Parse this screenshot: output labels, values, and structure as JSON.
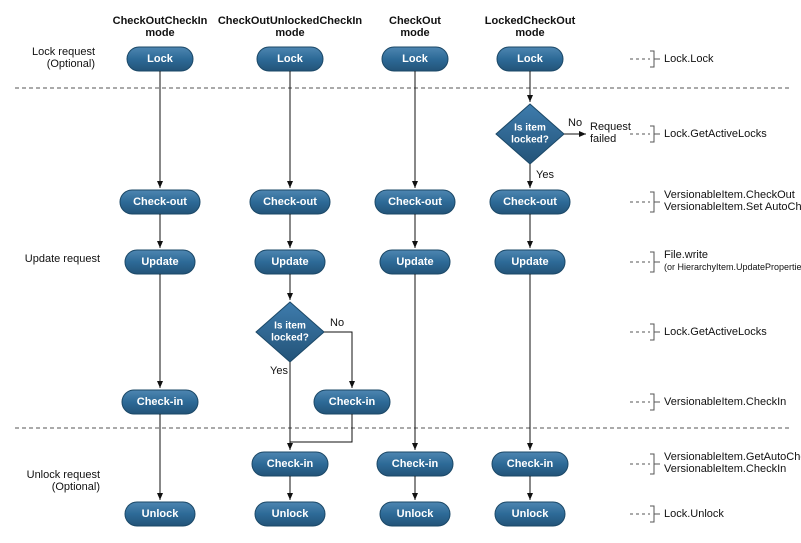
{
  "columns": [
    {
      "line1": "CheckOutCheckIn",
      "line2": "mode"
    },
    {
      "line1": "CheckOutUnlockedCheckIn",
      "line2": "mode"
    },
    {
      "line1": "CheckOut",
      "line2": "mode"
    },
    {
      "line1": "LockedCheckOut",
      "line2": "mode"
    }
  ],
  "row_labels": {
    "lock": {
      "l1": "Lock request",
      "l2": "(Optional)"
    },
    "update": "Update request",
    "unlock": {
      "l1": "Unlock request",
      "l2": "(Optional)"
    }
  },
  "nodes": {
    "lock": "Lock",
    "checkout": "Check-out",
    "update": "Update",
    "checkin": "Check-in",
    "unlock": "Unlock"
  },
  "decision": {
    "l1": "Is item",
    "l2": "locked?"
  },
  "branch": {
    "yes": "Yes",
    "no": "No",
    "request_failed1": "Request",
    "request_failed2": "failed"
  },
  "annotations": {
    "lock_lock": "Lock.Lock",
    "get_active_locks": "Lock.GetActiveLocks",
    "checkout_l1": "VersionableItem.CheckOut",
    "checkout_l2": "VersionableItem.Set AutoCheckIn",
    "file_write": "File.write",
    "file_write_sub": "(or   HierarchyItem.UpdateProperties)",
    "checkin": "VersionableItem.CheckIn",
    "auto_checkin_l1": "VersionableItem.GetAutoCheckIn",
    "auto_checkin_l2": "VersionableItem.CheckIn",
    "lock_unlock": "Lock.Unlock"
  }
}
